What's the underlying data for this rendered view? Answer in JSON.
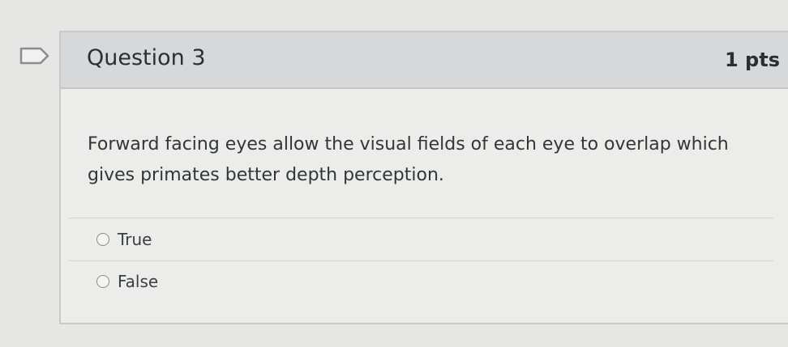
{
  "question": {
    "title": "Question 3",
    "points": "1 pts",
    "text": "Forward facing eyes allow the visual fields of each eye to overlap which gives primates better depth perception."
  },
  "answers": [
    {
      "label": "True",
      "selected": false
    },
    {
      "label": "False",
      "selected": false
    }
  ],
  "icons": {
    "flag": "flag-icon"
  },
  "colors": {
    "header_bg": "#d7d8da",
    "card_bg": "#ececea",
    "text": "#2b2f33"
  }
}
